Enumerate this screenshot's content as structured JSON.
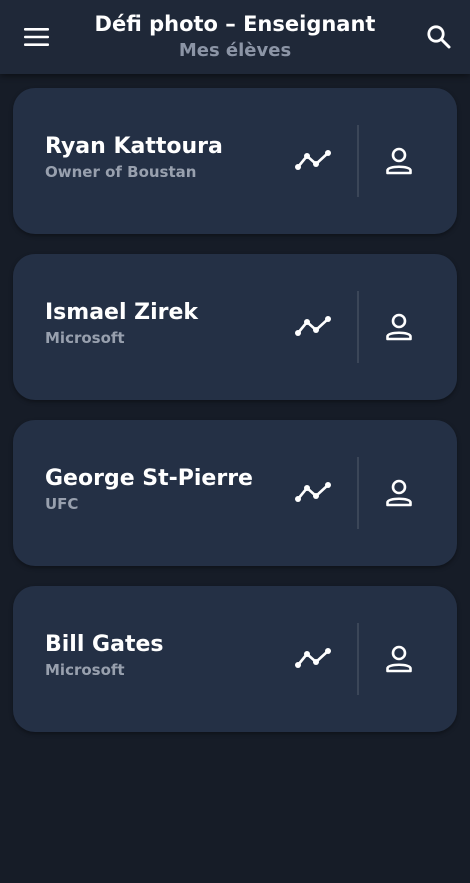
{
  "header": {
    "title": "Défi photo – Enseignant",
    "subtitle": "Mes élèves",
    "menu_icon": "menu-icon",
    "search_icon": "search-icon"
  },
  "students": [
    {
      "name": "Ryan Kattoura",
      "company": "Owner of Boustan"
    },
    {
      "name": "Ismael Zirek",
      "company": "Microsoft"
    },
    {
      "name": "George St-Pierre",
      "company": "UFC"
    },
    {
      "name": "Bill Gates",
      "company": "Microsoft"
    }
  ],
  "card_icons": {
    "progress": "trending-chart-icon",
    "profile": "person-icon"
  },
  "colors": {
    "background": "#161c27",
    "app_bar": "#1f2838",
    "card": "#243045",
    "subtitle": "#8c95a6",
    "secondary_text": "#98a0ae"
  }
}
